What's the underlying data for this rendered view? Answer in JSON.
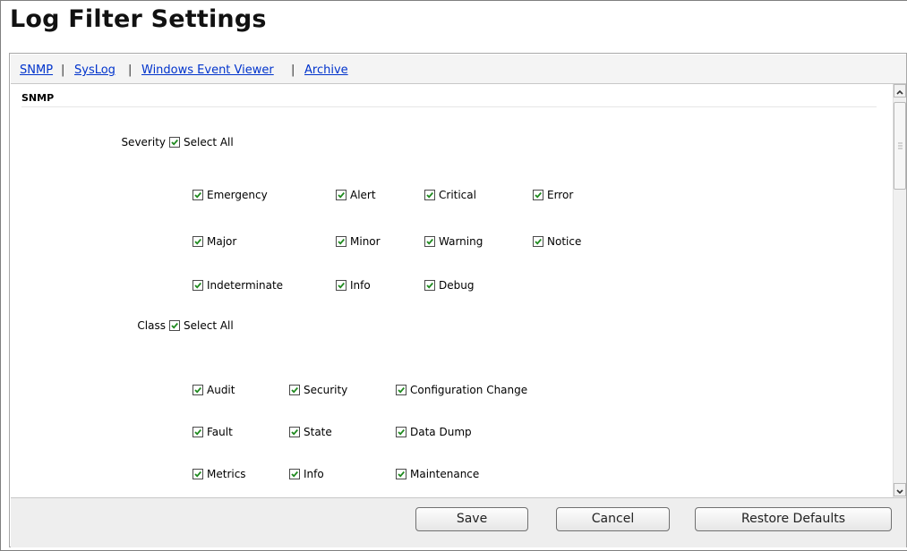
{
  "page_title": "Log Filter Settings",
  "nav": {
    "links": [
      "SNMP",
      "SysLog",
      "Windows Event Viewer",
      "Archive"
    ],
    "separator": "|"
  },
  "section_title": "SNMP",
  "severity": {
    "label": "Severity",
    "select_all": "Select All",
    "options": [
      "Emergency",
      "Alert",
      "Critical",
      "Error",
      "Major",
      "Minor",
      "Warning",
      "Notice",
      "Indeterminate",
      "Info",
      "Debug"
    ]
  },
  "class": {
    "label": "Class",
    "select_all": "Select All",
    "options": [
      "Audit",
      "Security",
      "Configuration Change",
      "Fault",
      "State",
      "Data Dump",
      "Metrics",
      "Info",
      "Maintenance"
    ]
  },
  "buttons": {
    "save": "Save",
    "cancel": "Cancel",
    "restore": "Restore Defaults"
  },
  "colors": {
    "check": "#1f8a1f",
    "link": "#0033cc"
  }
}
